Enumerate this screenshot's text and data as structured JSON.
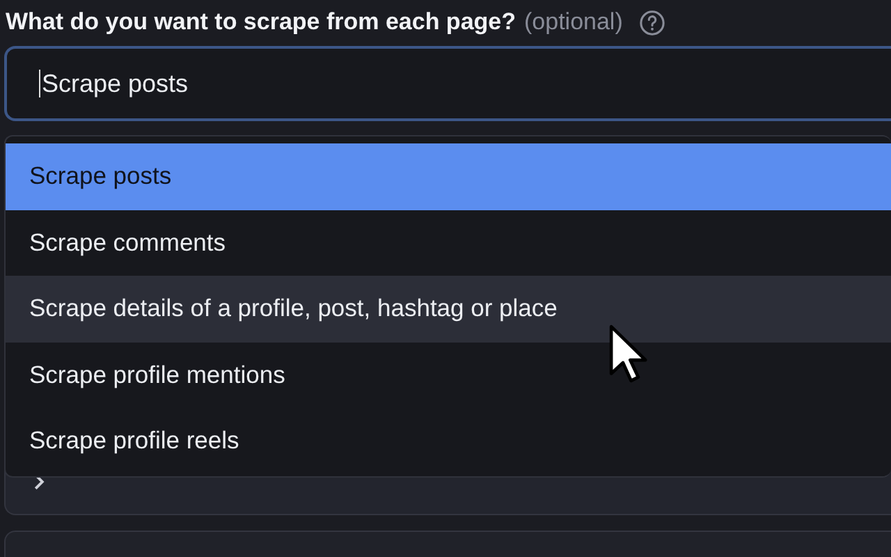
{
  "field": {
    "label": "What do you want to scrape from each page?",
    "hint": "(optional)",
    "value": "Scrape posts"
  },
  "options": [
    {
      "label": "Scrape posts",
      "selected": true,
      "hovered": false
    },
    {
      "label": "Scrape comments",
      "selected": false,
      "hovered": false
    },
    {
      "label": "Scrape details of a profile, post, hashtag or place",
      "selected": false,
      "hovered": true
    },
    {
      "label": "Scrape profile mentions",
      "selected": false,
      "hovered": false
    },
    {
      "label": "Scrape profile reels",
      "selected": false,
      "hovered": false
    }
  ],
  "section": {
    "expanded": false
  }
}
